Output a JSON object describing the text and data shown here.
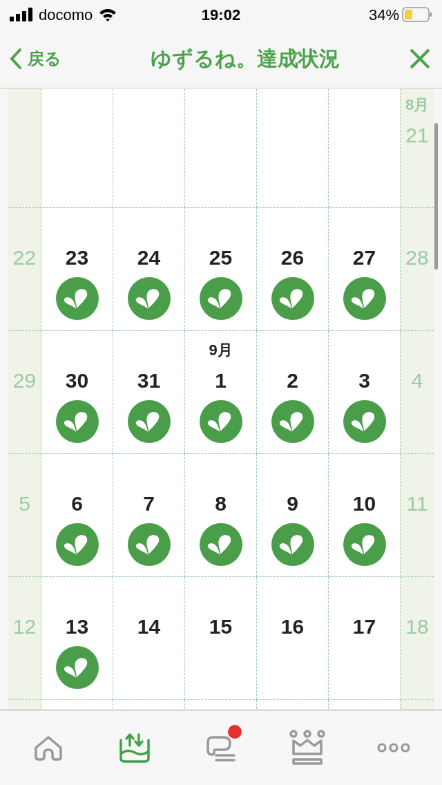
{
  "status_bar": {
    "carrier": "docomo",
    "time": "19:02",
    "battery": "34%"
  },
  "nav": {
    "back": "戻る",
    "title": "ゆずるね。達成状況"
  },
  "weeks": [
    {
      "cells": [
        {
          "kind": "weekend"
        },
        {
          "kind": "weekday"
        },
        {
          "kind": "weekday"
        },
        {
          "kind": "weekday"
        },
        {
          "kind": "weekday"
        },
        {
          "kind": "weekday"
        },
        {
          "kind": "weekend",
          "month": "8月",
          "day": "21"
        }
      ]
    },
    {
      "cells": [
        {
          "kind": "weekend",
          "day": "22"
        },
        {
          "kind": "weekday",
          "day": "23",
          "done": true
        },
        {
          "kind": "weekday",
          "day": "24",
          "done": true
        },
        {
          "kind": "weekday",
          "day": "25",
          "done": true
        },
        {
          "kind": "weekday",
          "day": "26",
          "done": true
        },
        {
          "kind": "weekday",
          "day": "27",
          "done": true
        },
        {
          "kind": "weekend",
          "day": "28"
        }
      ]
    },
    {
      "cells": [
        {
          "kind": "weekend",
          "day": "29"
        },
        {
          "kind": "weekday",
          "day": "30",
          "done": true
        },
        {
          "kind": "weekday",
          "day": "31",
          "done": true
        },
        {
          "kind": "weekday",
          "month": "9月",
          "day": "1",
          "done": true
        },
        {
          "kind": "weekday",
          "day": "2",
          "done": true
        },
        {
          "kind": "weekday",
          "day": "3",
          "done": true
        },
        {
          "kind": "weekend",
          "day": "4"
        }
      ]
    },
    {
      "cells": [
        {
          "kind": "weekend",
          "day": "5"
        },
        {
          "kind": "weekday",
          "day": "6",
          "done": true
        },
        {
          "kind": "weekday",
          "day": "7",
          "done": true
        },
        {
          "kind": "weekday",
          "day": "8",
          "done": true
        },
        {
          "kind": "weekday",
          "day": "9",
          "done": true
        },
        {
          "kind": "weekday",
          "day": "10",
          "done": true
        },
        {
          "kind": "weekend",
          "day": "11"
        }
      ]
    },
    {
      "cells": [
        {
          "kind": "weekend",
          "day": "12"
        },
        {
          "kind": "weekday",
          "day": "13",
          "done": true
        },
        {
          "kind": "weekday",
          "day": "14",
          "done": false
        },
        {
          "kind": "weekday",
          "day": "15",
          "done": false
        },
        {
          "kind": "weekday",
          "day": "16",
          "done": false
        },
        {
          "kind": "weekday",
          "day": "17",
          "done": false
        },
        {
          "kind": "weekend",
          "day": "18"
        }
      ]
    },
    {
      "cells": [
        {
          "kind": "weekend"
        },
        {
          "kind": "weekday"
        },
        {
          "kind": "weekday"
        },
        {
          "kind": "weekday"
        },
        {
          "kind": "weekday"
        },
        {
          "kind": "weekday"
        },
        {
          "kind": "weekend"
        }
      ]
    }
  ],
  "tabs": [
    {
      "kind": "home",
      "selected": false,
      "badge": false
    },
    {
      "kind": "tray",
      "selected": true,
      "badge": false
    },
    {
      "kind": "chat",
      "selected": false,
      "badge": true
    },
    {
      "kind": "crown",
      "selected": false,
      "badge": false
    },
    {
      "kind": "more",
      "selected": false,
      "badge": false
    }
  ]
}
